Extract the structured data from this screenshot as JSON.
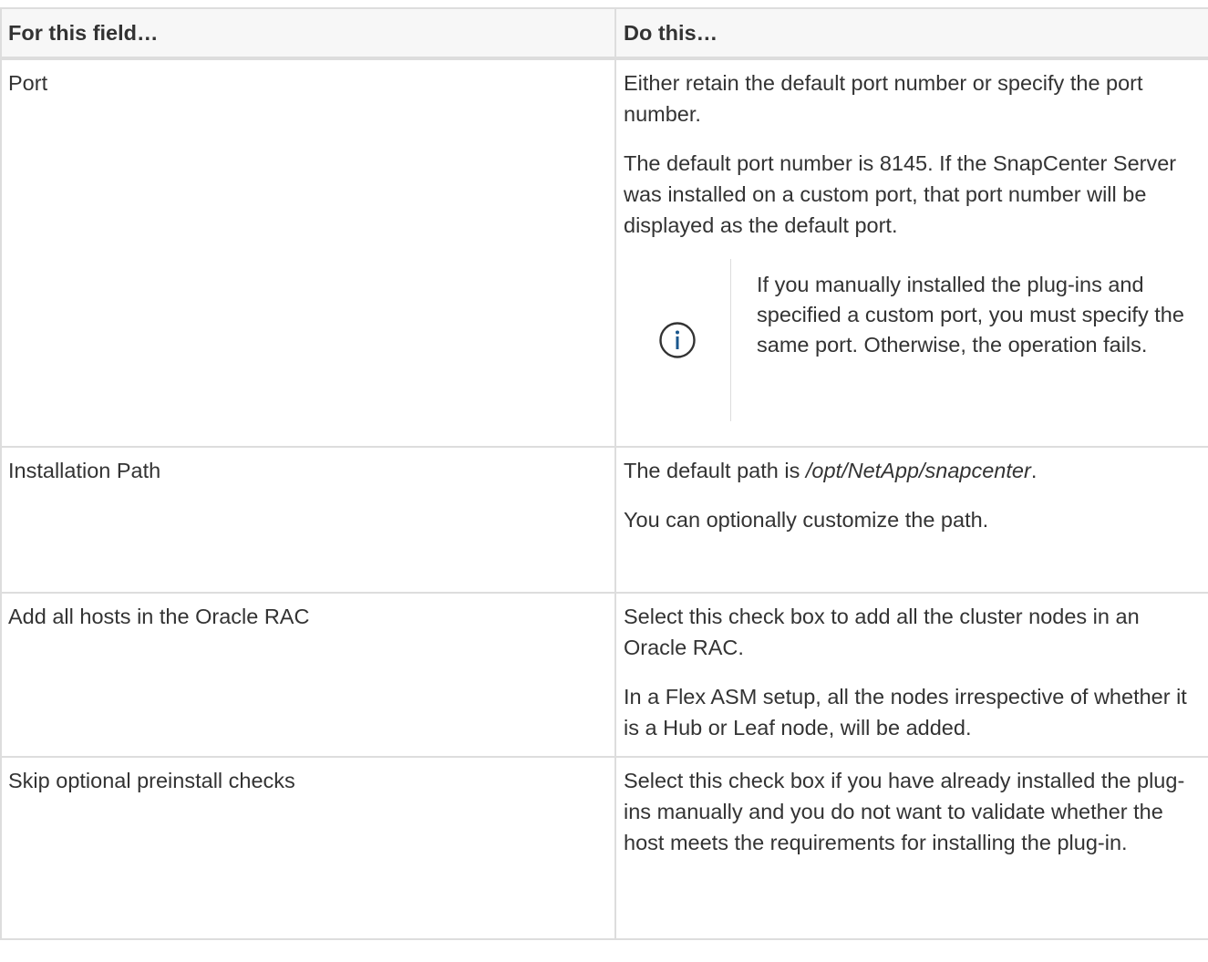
{
  "table": {
    "headers": [
      "For this field…",
      "Do this…"
    ],
    "rows": [
      {
        "field": "Port",
        "paragraphs": [
          "Either retain the default port number or specify the port number.",
          "The default port number is 8145. If the SnapCenter Server was installed on a custom port, that port number will be displayed as the default port."
        ],
        "note": "If you manually installed the plug-ins and specified a custom port, you must specify the same port. Otherwise, the operation fails.",
        "note_icon": "info-icon"
      },
      {
        "field": "Installation Path",
        "path_prefix": "The default path is ",
        "path_value": "/opt/NetApp/snapcenter",
        "path_suffix": ".",
        "paragraphs": [
          "You can optionally customize the path."
        ]
      },
      {
        "field": "Add all hosts in the Oracle RAC",
        "paragraphs": [
          "Select this check box to add all the cluster nodes in an Oracle RAC.",
          "In a Flex ASM setup, all the nodes irrespective of whether it is a Hub or Leaf node, will be added."
        ]
      },
      {
        "field": "Skip optional preinstall checks",
        "paragraphs": [
          "Select this check box if you have already installed the plug-ins manually and you do not want to validate whether the host meets the requirements for installing the plug-in."
        ]
      }
    ]
  },
  "colors": {
    "text": "#333333",
    "header_bg": "#f7f7f7",
    "border": "#dddddd",
    "info_icon": "#19568c"
  }
}
